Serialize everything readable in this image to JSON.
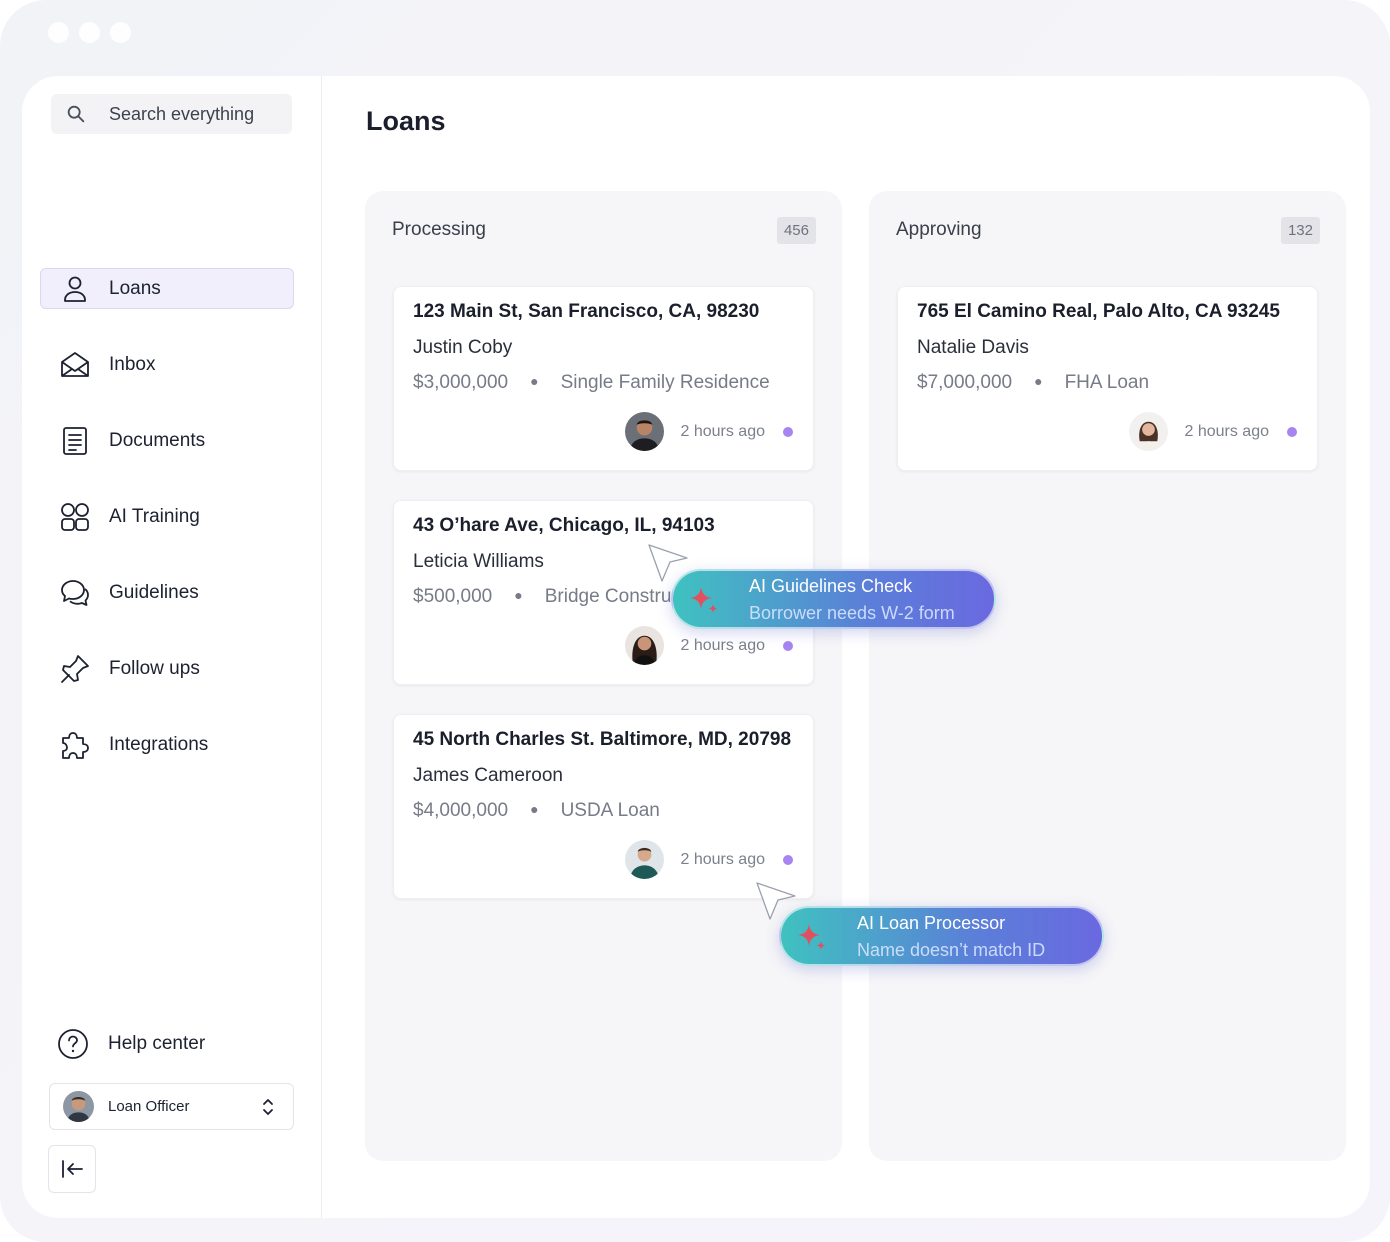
{
  "sidebar": {
    "search_placeholder": "Search everything",
    "items": [
      {
        "label": "Loans",
        "icon": "user-icon",
        "active": true
      },
      {
        "label": "Inbox",
        "icon": "envelope-open-icon"
      },
      {
        "label": "Documents",
        "icon": "document-icon"
      },
      {
        "label": "AI Training",
        "icon": "grid-icon"
      },
      {
        "label": "Guidelines",
        "icon": "chat-bubbles-icon"
      },
      {
        "label": "Follow ups",
        "icon": "pin-icon"
      },
      {
        "label": "Integrations",
        "icon": "puzzle-icon"
      }
    ],
    "help_label": "Help center",
    "user_role": "Loan Officer"
  },
  "main": {
    "title": "Loans",
    "columns": [
      {
        "name": "Processing",
        "count": "456",
        "cards": [
          {
            "address": "123 Main St, San Francisco, CA, 98230",
            "borrower": "Justin Coby",
            "amount": "$3,000,000",
            "loan_type": "Single Family Residence",
            "time": "2 hours ago"
          },
          {
            "address": "43 O’hare Ave, Chicago, IL, 94103",
            "borrower": "Leticia Williams",
            "amount": "$500,000",
            "loan_type": "Bridge Construction",
            "time": "2 hours ago"
          },
          {
            "address": "45 North Charles St. Baltimore, MD, 20798",
            "borrower": "James Cameroon",
            "amount": "$4,000,000",
            "loan_type": "USDA Loan",
            "time": "2 hours ago"
          }
        ]
      },
      {
        "name": "Approving",
        "count": "132",
        "cards": [
          {
            "address": "765 El Camino Real, Palo Alto, CA 93245",
            "borrower": "Natalie Davis",
            "amount": "$7,000,000",
            "loan_type": "FHA Loan",
            "time": "2 hours ago"
          }
        ]
      }
    ]
  },
  "ai_popups": [
    {
      "title": "AI Guidelines Check",
      "subtitle": "Borrower needs W-2 form"
    },
    {
      "title": "AI Loan Processor",
      "subtitle": "Name doesn’t match ID"
    }
  ],
  "colors": {
    "accent_purple": "#a884f0",
    "active_nav_bg": "#f1effc",
    "ai_gradient_start": "#3fc2c0",
    "ai_gradient_end": "#6a69e0",
    "sparkle": "#e0505e"
  }
}
